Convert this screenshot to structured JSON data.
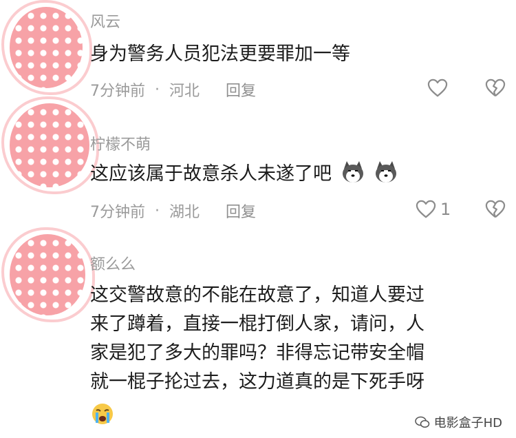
{
  "comments": [
    {
      "username": "风云",
      "text_lines": [
        "身为警务人员犯法更要罪加一等"
      ],
      "time": "7分钟前",
      "location": "河北",
      "reply_label": "回复",
      "like_count": ""
    },
    {
      "username": "柠檬不萌",
      "text_lines": [
        "这应该属于故意杀人未遂了吧"
      ],
      "time": "7分钟前",
      "location": "湖北",
      "reply_label": "回复",
      "like_count": "1",
      "emojis": [
        "husky-emoji",
        "husky-emoji"
      ]
    },
    {
      "username": "额么么",
      "text_lines": [
        "这交警故意的不能在故意了，知道人要过",
        "来了蹲着，直接一棍打倒人家，请问，人",
        "家是犯了多大的罪吗？非得忘记带安全帽",
        "就一棍子抡过去，这力道真的是下死手呀"
      ],
      "emojis": [
        "crying-emoji"
      ]
    }
  ],
  "meta_separator": "·",
  "watermark": {
    "text": "电影盒子HD"
  },
  "colors": {
    "avatar": "#f4a3a8",
    "meta_gray": "#9a9a9a"
  }
}
